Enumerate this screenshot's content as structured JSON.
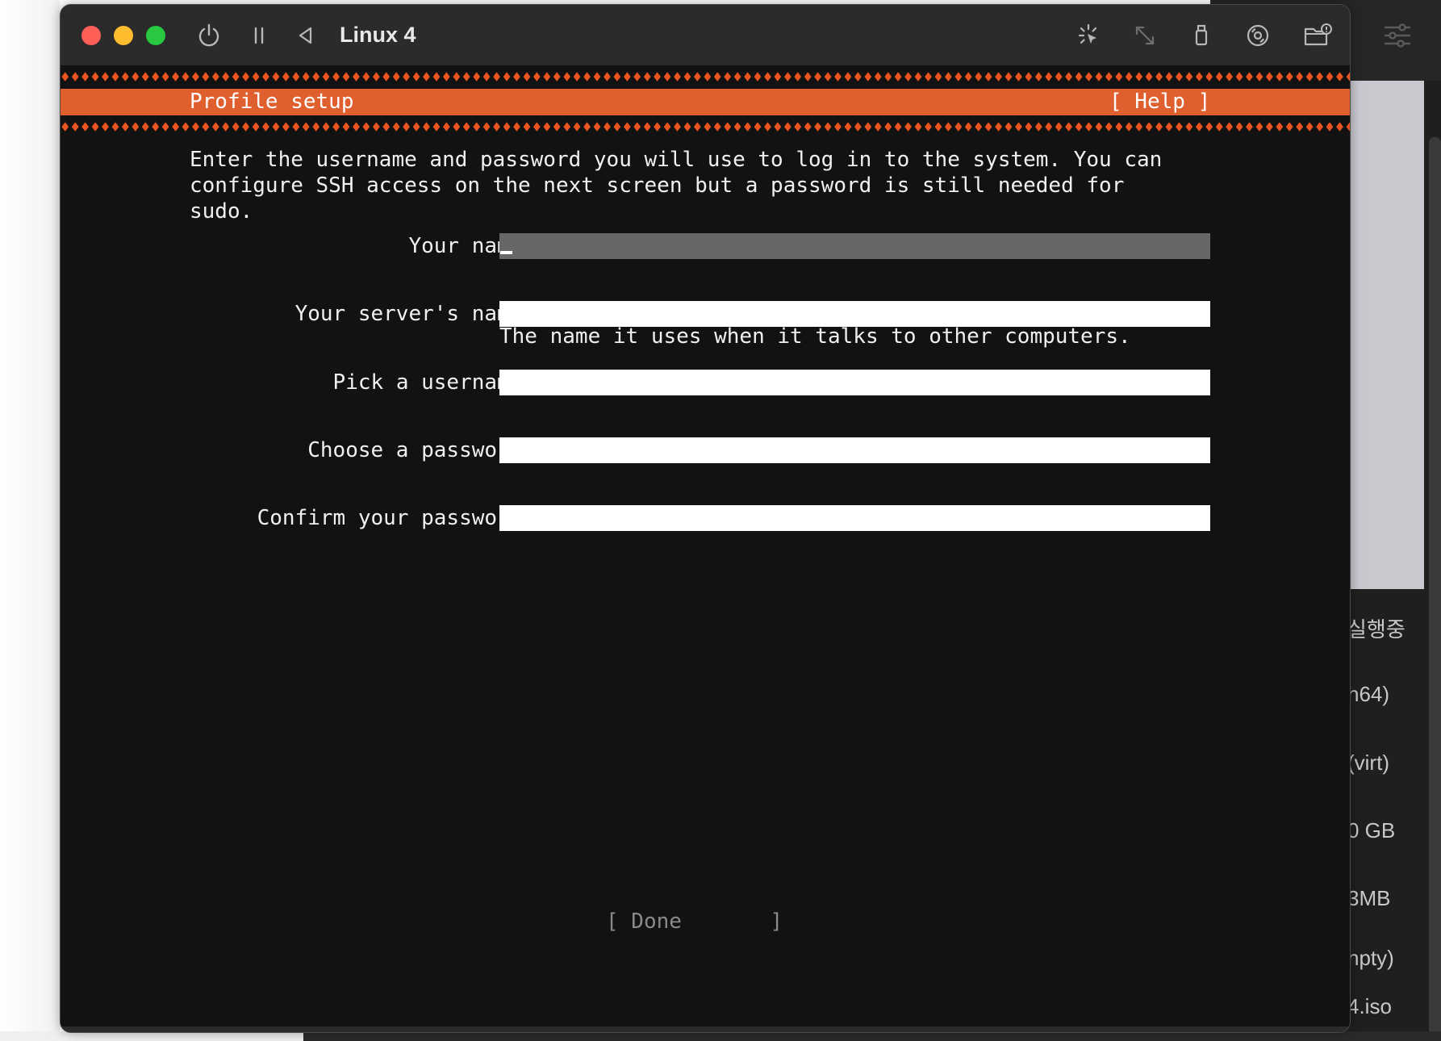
{
  "window": {
    "title": "Linux 4",
    "toolbar_icons": [
      "power-icon",
      "pause-icon",
      "back-icon",
      "pointer-capture-icon",
      "resize-icon",
      "usb-icon",
      "disc-icon",
      "shared-folder-icon"
    ]
  },
  "installer": {
    "header_title": "Profile setup",
    "help_label": "[ Help ]",
    "intro_text": "Enter the username and password you will use to log in to the system. You can\nconfigure SSH access on the next screen but a password is still needed for\nsudo.",
    "fields": {
      "your_name": {
        "label": "Your name:",
        "value": ""
      },
      "server_name": {
        "label": "Your server's name:",
        "value": "",
        "hint": "The name it uses when it talks to other computers."
      },
      "username": {
        "label": "Pick a username:",
        "value": ""
      },
      "password": {
        "label": "Choose a password:",
        "value": ""
      },
      "confirm_password": {
        "label": "Confirm your password:",
        "value": ""
      }
    },
    "done_label": "[ Done       ]"
  },
  "side_panel": {
    "items": [
      "실행중",
      "h64)",
      "(virt)",
      "0 GB",
      "3MB",
      "npty)",
      "4.iso"
    ]
  },
  "colors": {
    "accent": "#e95420",
    "header_bg": "#e05f2e",
    "terminal_bg": "#121212",
    "titlebar_bg": "#2b2b2b"
  }
}
